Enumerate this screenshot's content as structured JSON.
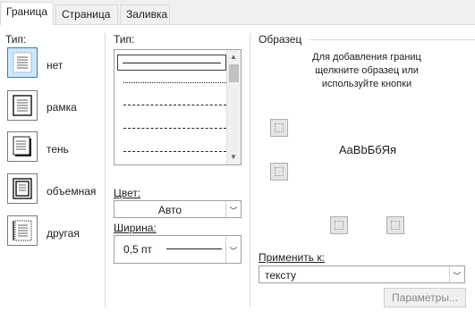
{
  "tabs": [
    {
      "label": "Граница",
      "active": true
    },
    {
      "label": "Страница",
      "active": false
    },
    {
      "label": "Заливка",
      "active": false
    }
  ],
  "type_section": {
    "title": "Тип:",
    "options": [
      {
        "label": "нет",
        "icon": "border-none-icon",
        "selected": true
      },
      {
        "label": "рамка",
        "icon": "border-box-icon",
        "selected": false
      },
      {
        "label": "тень",
        "icon": "border-shadow-icon",
        "selected": false
      },
      {
        "label": "объемная",
        "icon": "border-3d-icon",
        "selected": false
      },
      {
        "label": "другая",
        "icon": "border-custom-icon",
        "selected": false
      }
    ]
  },
  "style_section": {
    "title": "Тип:",
    "line_styles": [
      "solid",
      "dotted",
      "dashed-small",
      "dashed",
      "dash-dot"
    ],
    "color_label": "Цвет:",
    "color_value": "Авто",
    "width_label": "Ширина:",
    "width_value": "0,5 пт"
  },
  "preview_section": {
    "title": "Образец",
    "hint": "Для добавления границ щелкните образец или используйте кнопки",
    "sample_text": "AaBbБбЯя",
    "apply_label": "Применить к:",
    "apply_value": "тексту",
    "params_button": "Параметры..."
  },
  "colors": {
    "selected_fill": "#cde8ff",
    "selected_border": "#3c7fb1",
    "disabled_text": "#8a8a8a"
  }
}
